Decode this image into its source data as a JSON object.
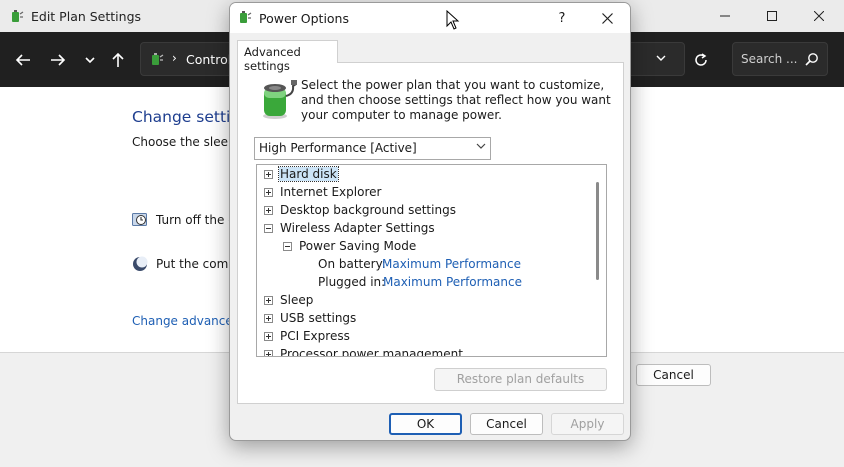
{
  "background_window": {
    "title": "Edit Plan Settings",
    "address_text": "Control",
    "search_placeholder": "Search ...",
    "heading": "Change settin",
    "subtext": "Choose the sleep a",
    "row1_text": "Turn off the d",
    "row2_text": "Put the comp",
    "link_text": "Change advanced",
    "cancel_label": "Cancel"
  },
  "dialog": {
    "title": "Power Options",
    "help_label": "?",
    "tab_label": "Advanced settings",
    "description": "Select the power plan that you want to customize, and then choose settings that reflect how you want your computer to manage power.",
    "plan_selected": "High Performance [Active]",
    "tree": {
      "hard_disk": "Hard disk",
      "internet_explorer": "Internet Explorer",
      "desktop_background": "Desktop background settings",
      "wireless_adapter": "Wireless Adapter Settings",
      "power_saving_mode": "Power Saving Mode",
      "on_battery_label": "On battery:",
      "on_battery_value": "Maximum Performance",
      "plugged_in_label": "Plugged in:",
      "plugged_in_value": "Maximum Performance",
      "sleep": "Sleep",
      "usb_settings": "USB settings",
      "pci_express": "PCI Express",
      "processor_power": "Processor power management"
    },
    "restore_label": "Restore plan defaults",
    "ok_label": "OK",
    "cancel_label": "Cancel",
    "apply_label": "Apply"
  },
  "colors": {
    "accent_blue": "#1e5fb4",
    "heading_blue": "#1e3e8f",
    "nav_dark": "#202020",
    "selection": "#cce4f7"
  },
  "icons": [
    "power-options-icon",
    "back-arrow-icon",
    "forward-arrow-icon",
    "chevron-down-icon",
    "up-arrow-icon",
    "refresh-icon",
    "search-icon",
    "clock-icon",
    "moon-icon",
    "battery-plug-icon",
    "close-icon",
    "help-icon",
    "mouse-cursor-icon"
  ]
}
